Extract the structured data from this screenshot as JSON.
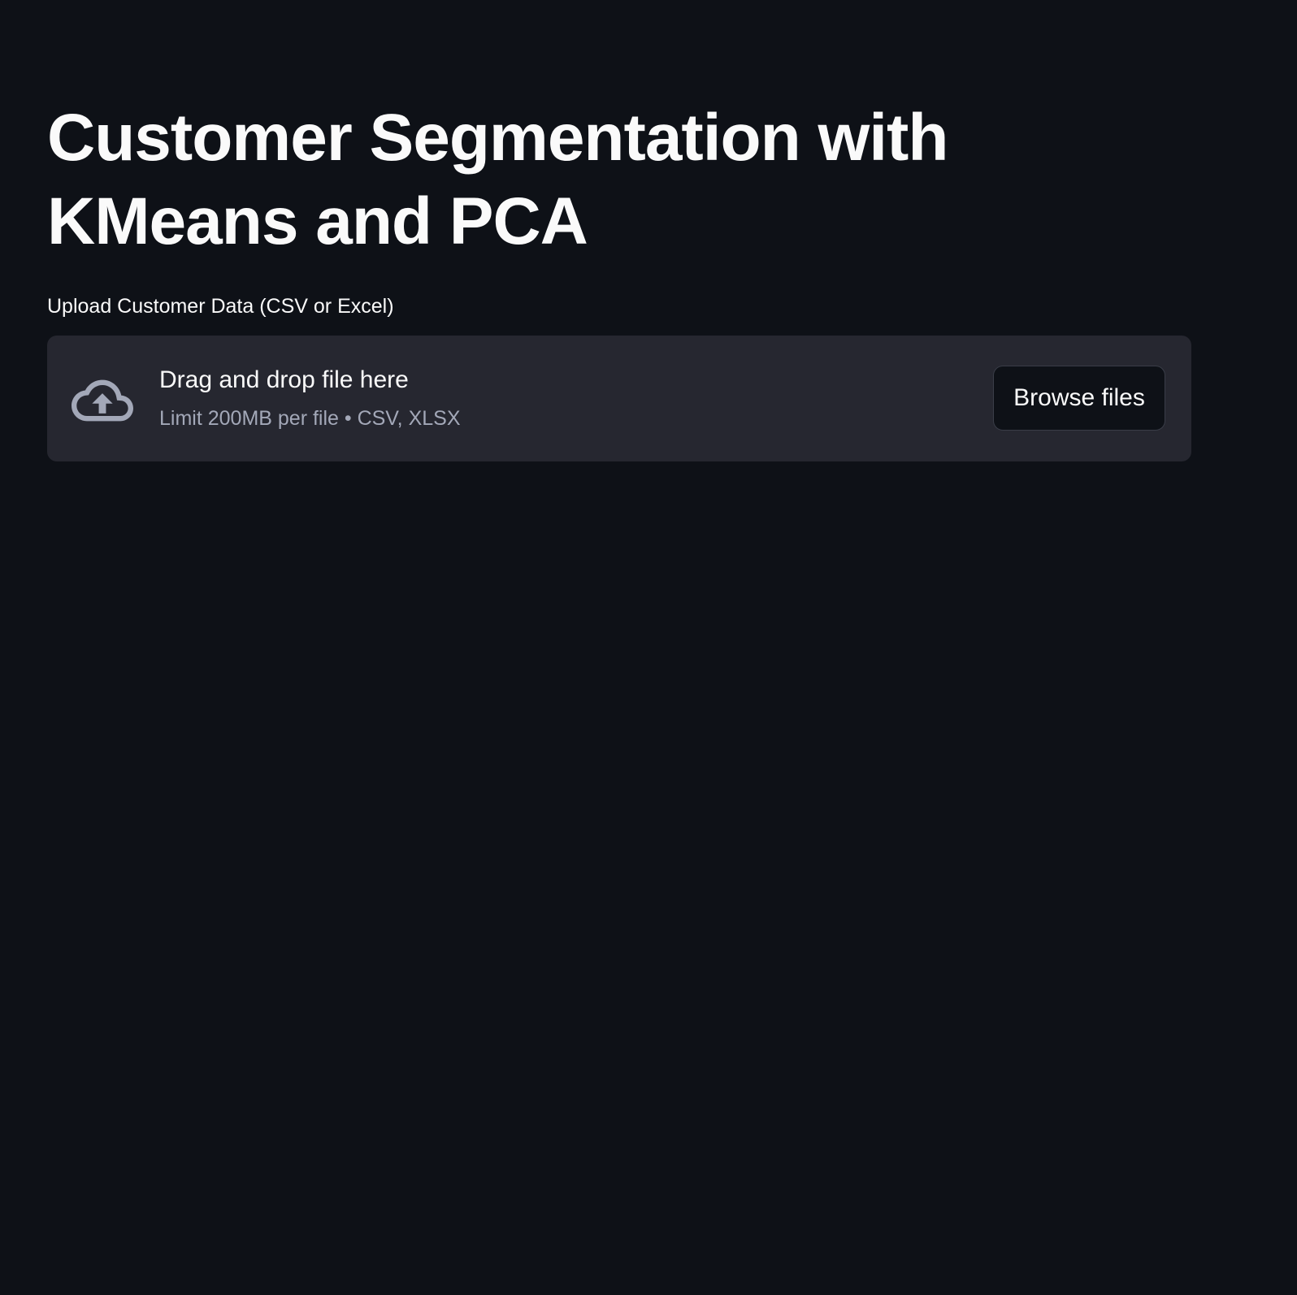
{
  "page": {
    "title": "Customer Segmentation with KMeans and PCA"
  },
  "uploader": {
    "label": "Upload Customer Data (CSV or Excel)",
    "dropzone_title": "Drag and drop file here",
    "dropzone_limit": "Limit 200MB per file • CSV, XLSX",
    "browse_label": "Browse files",
    "icon": "cloud-upload-icon"
  },
  "colors": {
    "background": "#0e1117",
    "dropzone": "#262730",
    "text": "#fafafa",
    "muted_text": "#a3a8b8"
  }
}
